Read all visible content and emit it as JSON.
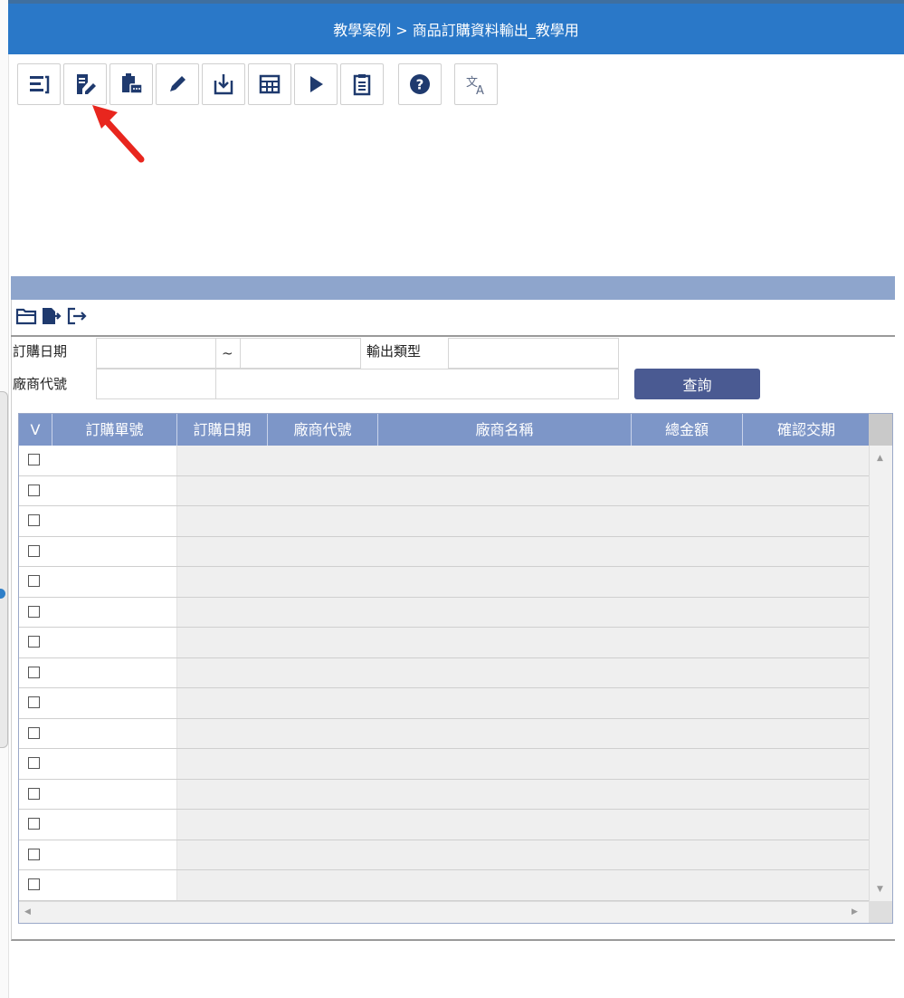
{
  "window": {
    "title": "教學案例  >  商品訂購資料輸出_教學用"
  },
  "toolbar": {
    "buttons": [
      {
        "icon": "list-sort-icon"
      },
      {
        "icon": "edit-document-icon"
      },
      {
        "icon": "clipboard-chat-icon"
      },
      {
        "icon": "pencil-icon"
      },
      {
        "icon": "import-icon"
      },
      {
        "icon": "table-icon"
      },
      {
        "icon": "play-icon"
      },
      {
        "icon": "clipboard-list-icon"
      },
      {
        "icon": "help-icon"
      },
      {
        "icon": "translate-icon"
      }
    ]
  },
  "panel": {
    "mini_tools": [
      {
        "icon": "folder-open-icon"
      },
      {
        "icon": "file-export-icon"
      },
      {
        "icon": "exit-icon"
      }
    ]
  },
  "form": {
    "order_date_label": "訂購日期",
    "order_date_from": "",
    "range_sep": "~",
    "order_date_to": "",
    "output_type_label": "輸出類型",
    "output_type_value": "",
    "vendor_code_label": "廠商代號",
    "vendor_code_value": "",
    "vendor_name_value": "",
    "query_button": "查詢"
  },
  "grid": {
    "columns": [
      "V",
      "訂購單號",
      "訂購日期",
      "廠商代號",
      "廠商名稱",
      "總金額",
      "確認交期"
    ],
    "rows": 15
  },
  "colors": {
    "titlebar": "#2a78c8",
    "panel_bar": "#8ea5cc",
    "grid_header": "#7d96c8",
    "query_button": "#4a5a92",
    "arrow": "#e8261e"
  }
}
